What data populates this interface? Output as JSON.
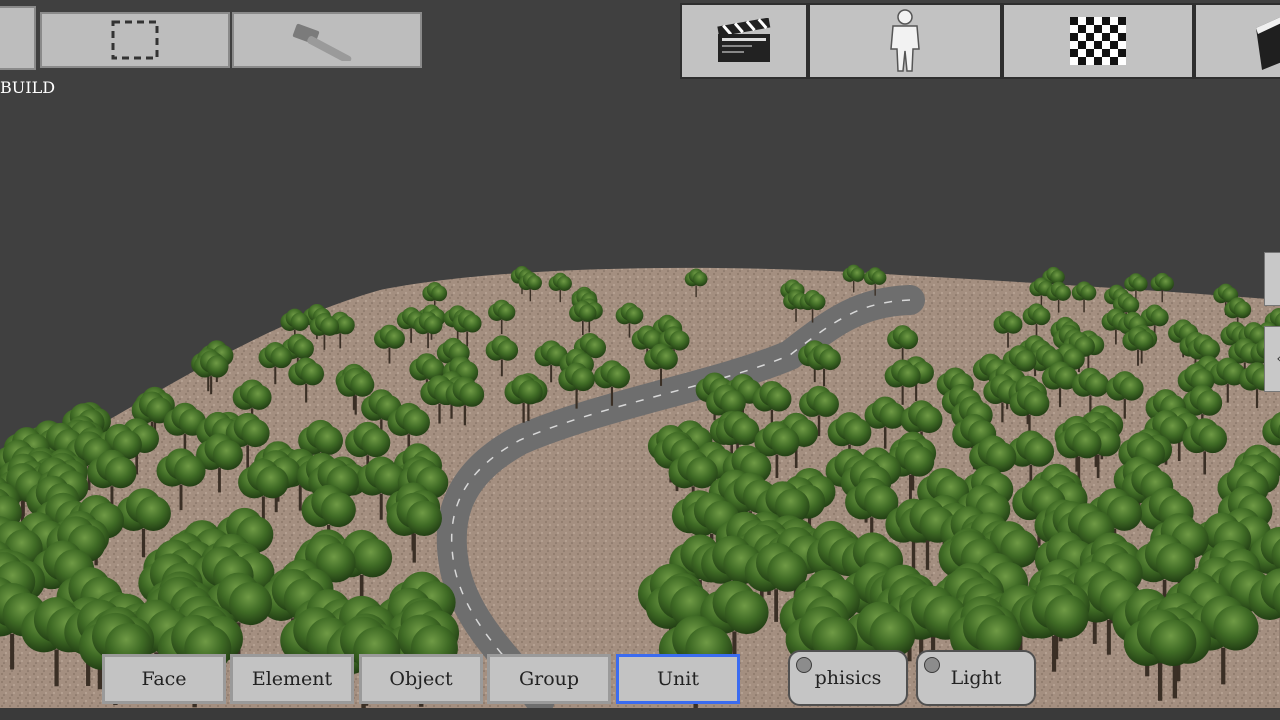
{
  "scene": {
    "colors": {
      "sky": "#404040",
      "ground": "#a89282",
      "road": "#6e6e6e",
      "tree": "#3f6b25"
    }
  },
  "toolbar": {
    "build_label": "BUILD",
    "left_buttons": [
      {
        "icon": "panel-icon"
      },
      {
        "icon": "selection-rect-icon"
      },
      {
        "icon": "hammer-icon"
      }
    ],
    "right_buttons": [
      {
        "icon": "clapperboard-icon"
      },
      {
        "icon": "person-icon"
      },
      {
        "icon": "checkerboard-icon"
      },
      {
        "icon": "cube-icon"
      }
    ]
  },
  "modes": {
    "items": [
      "Face",
      "Element",
      "Object",
      "Group",
      "Unit"
    ],
    "selected": "Unit"
  },
  "toggles": {
    "physics_label": "phisics",
    "light_label": "Light"
  }
}
